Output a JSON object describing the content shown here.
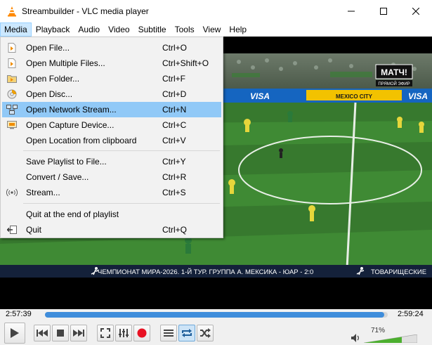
{
  "window": {
    "title": "Streambuilder - VLC media player"
  },
  "menubar": {
    "items": [
      "Media",
      "Playback",
      "Audio",
      "Video",
      "Subtitle",
      "Tools",
      "View",
      "Help"
    ],
    "active": "Media"
  },
  "media_menu": {
    "items": [
      {
        "label": "Open File...",
        "shortcut": "Ctrl+O",
        "icon": "file-icon"
      },
      {
        "label": "Open Multiple Files...",
        "shortcut": "Ctrl+Shift+O",
        "icon": "files-icon"
      },
      {
        "label": "Open Folder...",
        "shortcut": "Ctrl+F",
        "icon": "folder-icon"
      },
      {
        "label": "Open Disc...",
        "shortcut": "Ctrl+D",
        "icon": "disc-icon"
      },
      {
        "label": "Open Network Stream...",
        "shortcut": "Ctrl+N",
        "icon": "network-icon",
        "highlighted": true
      },
      {
        "label": "Open Capture Device...",
        "shortcut": "Ctrl+C",
        "icon": "capture-icon"
      },
      {
        "label": "Open Location from clipboard",
        "shortcut": "Ctrl+V",
        "icon": ""
      },
      {
        "label": "Save Playlist to File...",
        "shortcut": "Ctrl+Y",
        "icon": ""
      },
      {
        "label": "Convert / Save...",
        "shortcut": "Ctrl+R",
        "icon": ""
      },
      {
        "label": "Stream...",
        "shortcut": "Ctrl+S",
        "icon": "stream-icon"
      },
      {
        "label": "Quit at the end of playlist",
        "shortcut": "",
        "icon": ""
      },
      {
        "label": "Quit",
        "shortcut": "Ctrl+Q",
        "icon": "quit-icon"
      }
    ]
  },
  "video": {
    "channel_logo": "МАТЧ!",
    "channel_sub": "ПРЯМОЙ ЭФИР",
    "board_text": "MEXICO CITY",
    "ad_text": "VISA",
    "ticker": "ЧЕМПИОНАТ МИРА-2026. 1-Й ТУР. ГРУППА А. МЕКСИКА - ЮАР - 2:0",
    "ticker_next": "ТОВАРИЩЕСКИЕ"
  },
  "player": {
    "elapsed": "2:57:39",
    "total": "2:59:24",
    "progress": 0.99,
    "volume_label": "71%",
    "volume": 0.71
  },
  "colors": {
    "accent": "#3f8ddb",
    "menu_highlight": "#91c9f7",
    "record": "#e81123",
    "pitch": "#3f8a34"
  }
}
